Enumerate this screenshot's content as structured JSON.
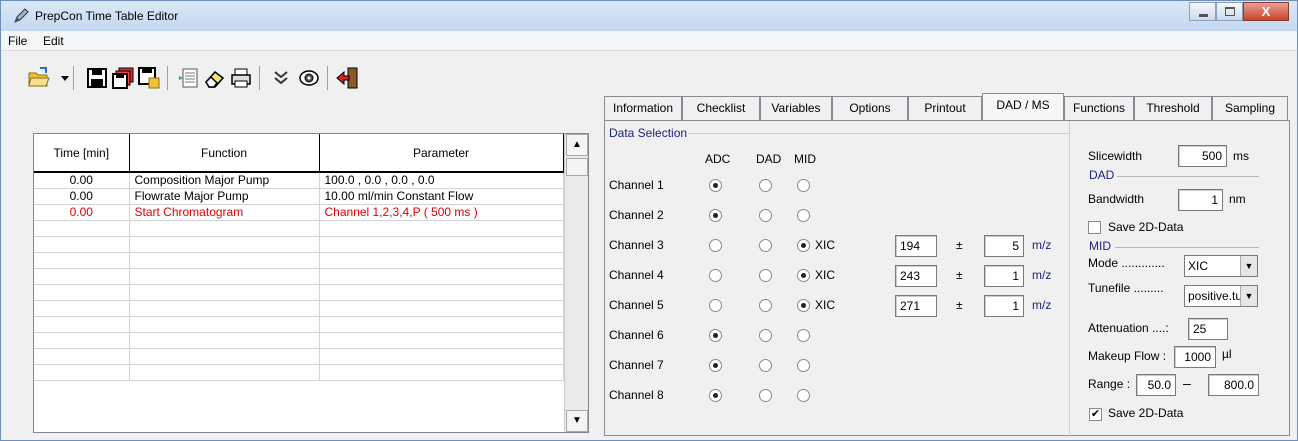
{
  "window": {
    "title": "PrepCon Time Table Editor",
    "close_glyph": "X"
  },
  "menu": [
    "File",
    "Edit"
  ],
  "toolbar": {
    "icons": [
      "open-folder-icon",
      "dropdown-arrow-icon",
      "save-icon",
      "save-all-icon",
      "save-lock-icon",
      "insert-row-icon",
      "eraser-icon",
      "print-icon",
      "expand-down-icon",
      "view-eye-icon",
      "exit-icon"
    ]
  },
  "table": {
    "headers": [
      "Time [min]",
      "Function",
      "Parameter"
    ],
    "rows": [
      {
        "time": "0.00",
        "function": "Composition Major Pump",
        "parameter": "100.0  ,  0.0  ,  0.0  ,  0.0",
        "color": "#000000"
      },
      {
        "time": "0.00",
        "function": "Flowrate Major Pump",
        "parameter": "10.00  ml/min Constant Flow",
        "color": "#000000"
      },
      {
        "time": "0.00",
        "function": "Start Chromatogram",
        "parameter": "Channel 1,2,3,4,P ( 500 ms )",
        "color": "#e00000"
      }
    ],
    "empty_rows": 10
  },
  "tabs": [
    {
      "label": "Information",
      "active": false
    },
    {
      "label": "Checklist",
      "active": false
    },
    {
      "label": "Variables",
      "active": false
    },
    {
      "label": "Options",
      "active": false
    },
    {
      "label": "Printout",
      "active": false
    },
    {
      "label": "DAD / MS",
      "active": true
    },
    {
      "label": "Functions",
      "active": false
    },
    {
      "label": "Threshold",
      "active": false
    },
    {
      "label": "Sampling",
      "active": false
    }
  ],
  "data_selection": {
    "group_label": "Data Selection",
    "col_headers": [
      "ADC",
      "DAD",
      "MID"
    ],
    "xic_label": "XIC",
    "pm": "±",
    "unit": "m/z",
    "channels": [
      {
        "label": "Channel 1",
        "selected": "ADC"
      },
      {
        "label": "Channel 2",
        "selected": "ADC"
      },
      {
        "label": "Channel 3",
        "selected": "MID",
        "mass": "194",
        "tol": "5"
      },
      {
        "label": "Channel 4",
        "selected": "MID",
        "mass": "243",
        "tol": "1"
      },
      {
        "label": "Channel 5",
        "selected": "MID",
        "mass": "271",
        "tol": "1"
      },
      {
        "label": "Channel 6",
        "selected": "ADC"
      },
      {
        "label": "Channel 7",
        "selected": "ADC"
      },
      {
        "label": "Channel 8",
        "selected": "ADC"
      }
    ]
  },
  "right": {
    "slicewidth_label": "Slicewidth",
    "slicewidth": "500",
    "slicewidth_unit": "ms",
    "dad_label": "DAD",
    "bandwidth_label": "Bandwidth",
    "bandwidth": "1",
    "bandwidth_unit": "nm",
    "dad_save_label": "Save 2D-Data",
    "dad_save_checked": false,
    "mid_label": "MID",
    "mode_label": "Mode .............",
    "mode": "XIC",
    "tunefile_label": "Tunefile .........",
    "tunefile": "positive.tu",
    "attenuation_label": "Attenuation ....:",
    "attenuation": "25",
    "makeup_label": "Makeup Flow :",
    "makeup": "1000",
    "makeup_unit": "µl",
    "range_label": "Range :",
    "range_from": "50.0",
    "range_sep": "–",
    "range_to": "800.0",
    "mid_save_label": "Save 2D-Data",
    "mid_save_checked": true,
    "check_glyph": "✔"
  }
}
